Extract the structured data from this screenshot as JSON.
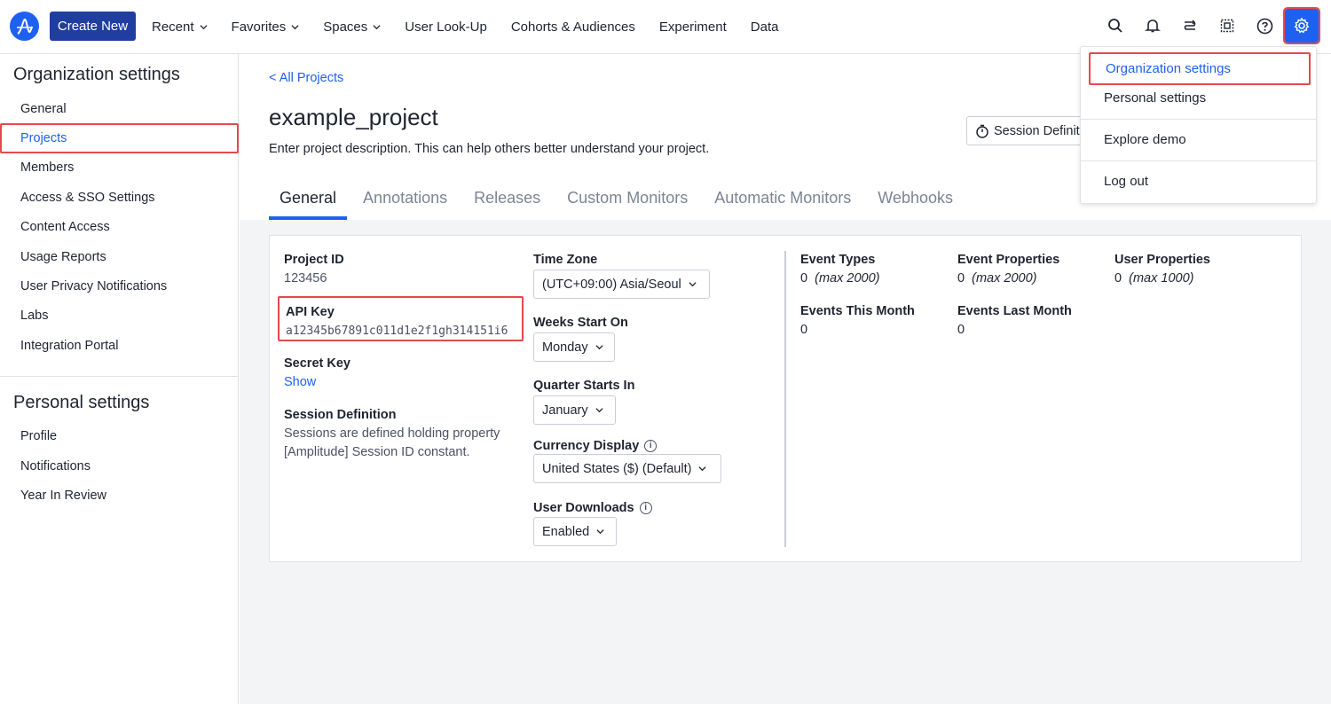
{
  "nav": {
    "create_new": "Create New",
    "items": [
      "Recent",
      "Favorites",
      "Spaces",
      "User Look-Up",
      "Cohorts & Audiences",
      "Experiment",
      "Data"
    ]
  },
  "sidebar": {
    "org_title": "Organization settings",
    "org_items": [
      "General",
      "Projects",
      "Members",
      "Access & SSO Settings",
      "Content Access",
      "Usage Reports",
      "User Privacy Notifications",
      "Labs",
      "Integration Portal"
    ],
    "personal_title": "Personal settings",
    "personal_items": [
      "Profile",
      "Notifications",
      "Year In Review"
    ]
  },
  "main": {
    "back_link": "< All Projects",
    "title": "example_project",
    "description": "Enter project description. This can help others better understand your project.",
    "session_button": "Session Definit",
    "tabs": [
      "General",
      "Annotations",
      "Releases",
      "Custom Monitors",
      "Automatic Monitors",
      "Webhooks"
    ]
  },
  "card": {
    "project_id_label": "Project ID",
    "project_id": "123456",
    "api_key_label": "API Key",
    "api_key": "a12345b67891c011d1e2f1gh314151i6",
    "secret_key_label": "Secret Key",
    "secret_key_link": "Show",
    "session_def_label": "Session Definition",
    "session_def_line1": "Sessions are defined holding property",
    "session_def_line2": "[Amplitude] Session ID constant.",
    "time_zone_label": "Time Zone",
    "time_zone": "(UTC+09:00) Asia/Seoul",
    "weeks_start_label": "Weeks Start On",
    "weeks_start": "Monday",
    "quarter_label": "Quarter Starts In",
    "quarter": "January",
    "currency_label": "Currency Display",
    "currency": "United States ($) (Default)",
    "downloads_label": "User Downloads",
    "downloads": "Enabled",
    "event_types_label": "Event Types",
    "event_types_val": "0",
    "event_types_max": "(max 2000)",
    "event_props_label": "Event Properties",
    "event_props_val": "0",
    "event_props_max": "(max 2000)",
    "user_props_label": "User Properties",
    "user_props_val": "0",
    "user_props_max": "(max 1000)",
    "events_this_month_label": "Events This Month",
    "events_this_month": "0",
    "events_last_month_label": "Events Last Month",
    "events_last_month": "0"
  },
  "dropdown": {
    "items": [
      "Organization settings",
      "Personal settings",
      "Explore demo",
      "Log out"
    ]
  },
  "colors": {
    "accent": "#1e61f0",
    "highlight": "#e5484d",
    "create_btn": "#1f3ea0"
  }
}
